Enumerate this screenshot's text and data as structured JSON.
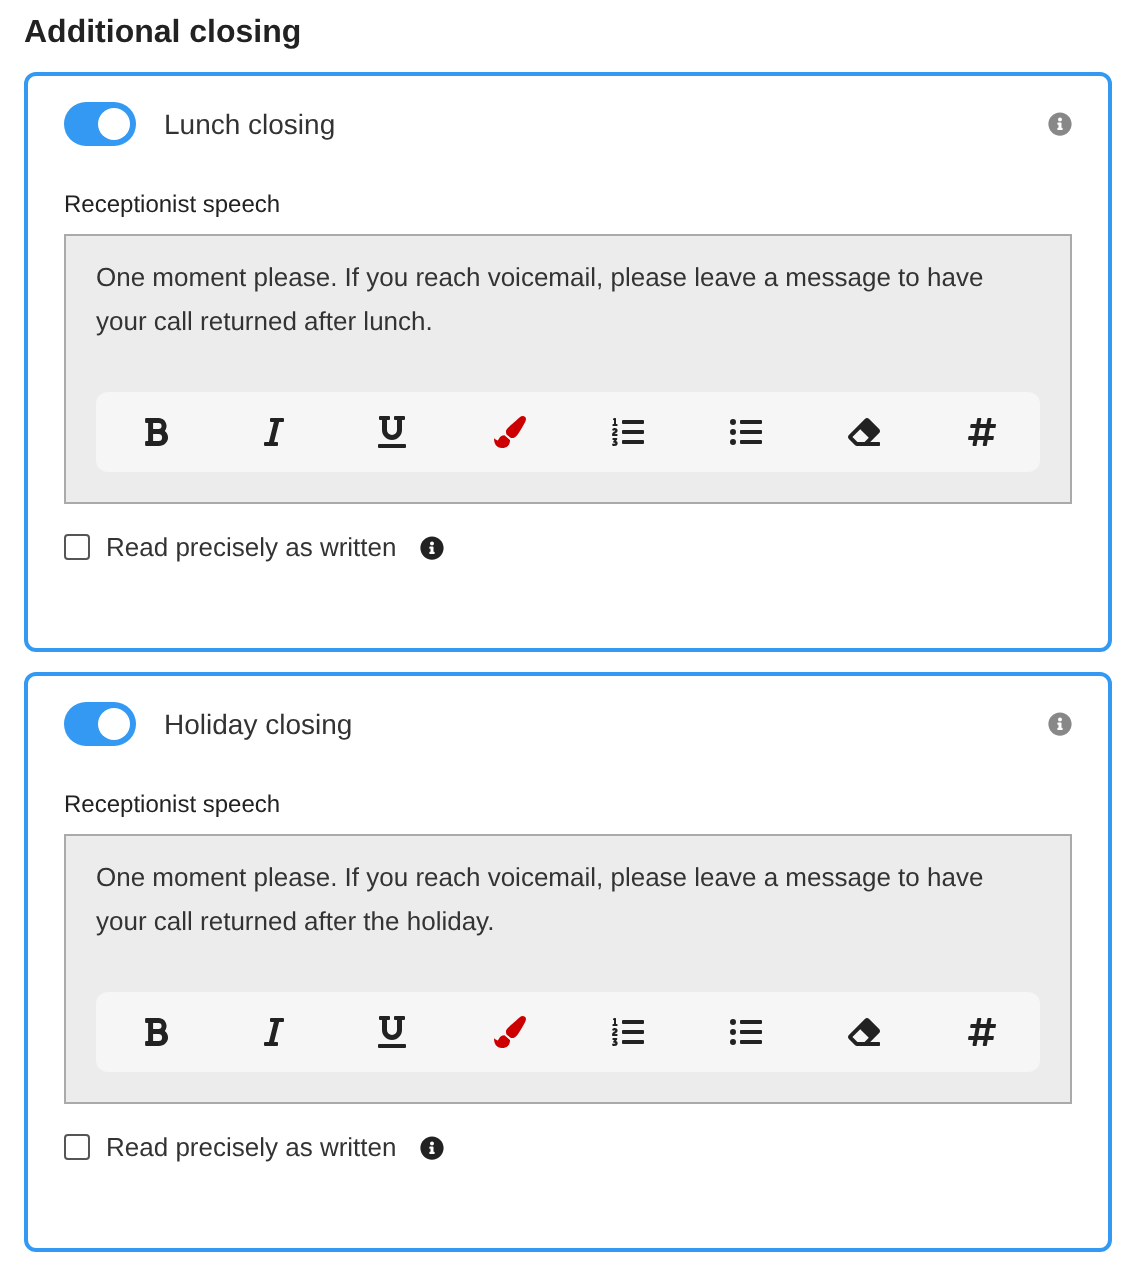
{
  "title": "Additional closing",
  "sections": [
    {
      "label": "Lunch closing",
      "on": true,
      "field_label": "Receptionist speech",
      "value": "One moment please. If you reach voicemail, please leave a message to have your call returned after lunch.",
      "checkbox": {
        "label": "Read precisely as written",
        "checked": false
      }
    },
    {
      "label": "Holiday closing",
      "on": true,
      "field_label": "Receptionist speech",
      "value": "One moment please. If you reach voicemail, please leave a message to have your call returned after the holiday.",
      "checkbox": {
        "label": "Read precisely as written",
        "checked": false
      }
    }
  ]
}
